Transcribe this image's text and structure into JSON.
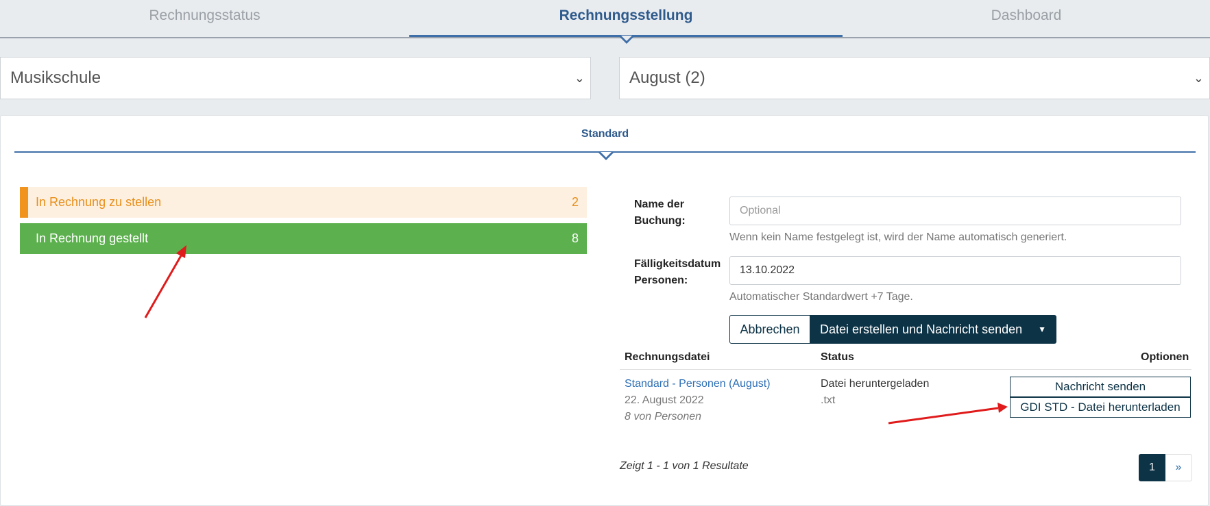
{
  "top_tabs": [
    {
      "label": "Rechnungsstatus",
      "active": false
    },
    {
      "label": "Rechnungsstellung",
      "active": true
    },
    {
      "label": "Dashboard",
      "active": false
    }
  ],
  "filters": {
    "school": "Musikschule",
    "month": "August (2)"
  },
  "subtab": "Standard",
  "status_list": [
    {
      "label": "In Rechnung zu stellen",
      "count": "2",
      "color": "#f0941e"
    },
    {
      "label": "In Rechnung gestellt",
      "count": "8",
      "color": "#5cb04e"
    }
  ],
  "form": {
    "name_label_line1": "Name der",
    "name_label_line2": "Buchung:",
    "name_placeholder": "Optional",
    "name_help": "Wenn kein Name festgelegt ist, wird der Name automatisch generiert.",
    "due_label_line1": "Fälligkeitsdatum",
    "due_label_line2": "Personen:",
    "due_value": "13.10.2022",
    "due_help": "Automatischer Standardwert +7 Tage.",
    "cancel_label": "Abbrechen",
    "submit_label": "Datei erstellen und Nachricht senden"
  },
  "table": {
    "headers": [
      "Rechnungsdatei",
      "Status",
      "Optionen"
    ],
    "rows": [
      {
        "file_link": "Standard - Personen (August)",
        "file_date": "22. August 2022",
        "file_count": "8 von Personen",
        "status": "Datei heruntergeladen",
        "status_ext": ".txt",
        "option_send": "Nachricht senden",
        "option_download": "GDI STD - Datei herunterladen"
      }
    ]
  },
  "pagination": {
    "summary": "Zeigt 1 - 1 von 1 Resultate",
    "current": "1",
    "next": "»"
  },
  "colors": {
    "accent": "#0d3346",
    "link": "#2e6fb5",
    "tab_active": "#2e5a8c",
    "annotation_arrow": "#e01b1b"
  }
}
